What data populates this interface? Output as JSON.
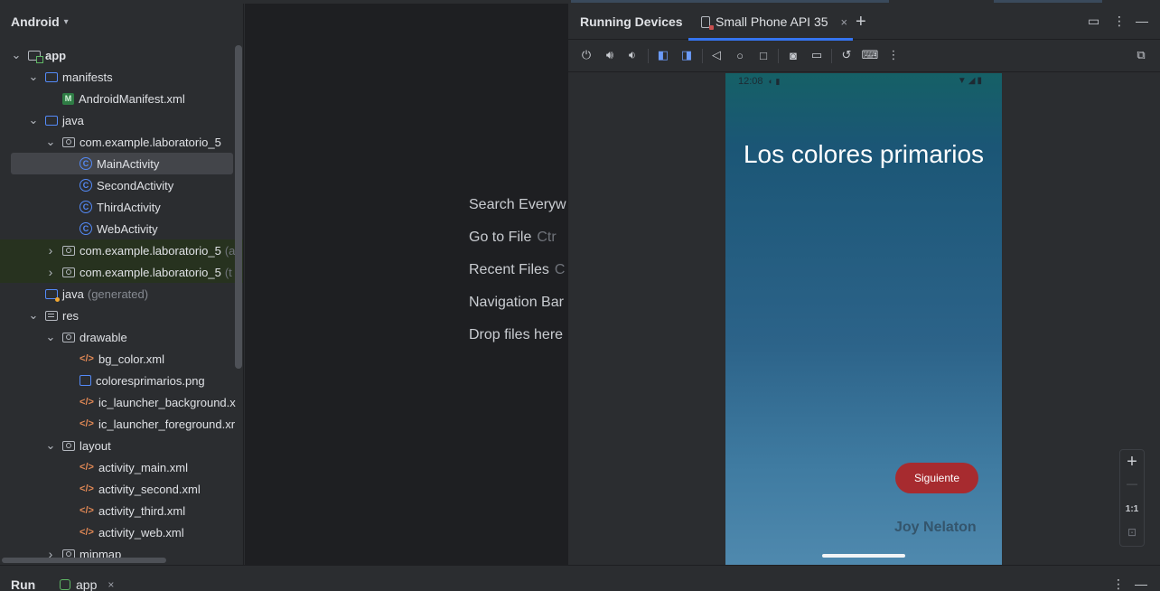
{
  "project": {
    "header": "Android",
    "items": [
      {
        "label": "app",
        "suffix": "",
        "type": "folder-app",
        "arrow": "open"
      },
      {
        "label": "manifests",
        "suffix": "",
        "type": "folder",
        "arrow": "open"
      },
      {
        "label": "AndroidManifest.xml",
        "suffix": "",
        "type": "manifest",
        "arrow": "none"
      },
      {
        "label": "java",
        "suffix": "",
        "type": "folder",
        "arrow": "open"
      },
      {
        "label": "com.example.laboratorio_5",
        "suffix": "",
        "type": "pkg",
        "arrow": "open"
      },
      {
        "label": "MainActivity",
        "suffix": "",
        "type": "cls",
        "arrow": "none",
        "selected": true
      },
      {
        "label": "SecondActivity",
        "suffix": "",
        "type": "cls",
        "arrow": "none"
      },
      {
        "label": "ThirdActivity",
        "suffix": "",
        "type": "cls",
        "arrow": "none"
      },
      {
        "label": "WebActivity",
        "suffix": "",
        "type": "cls",
        "arrow": "none"
      },
      {
        "label": "com.example.laboratorio_5",
        "suffix": "(a",
        "type": "pkg",
        "arrow": "closed",
        "green": true
      },
      {
        "label": "com.example.laboratorio_5",
        "suffix": "(t",
        "type": "pkg",
        "arrow": "closed",
        "green": true
      },
      {
        "label": "java",
        "suffix": "(generated)",
        "type": "gen",
        "arrow": "none"
      },
      {
        "label": "res",
        "suffix": "",
        "type": "res",
        "arrow": "open"
      },
      {
        "label": "drawable",
        "suffix": "",
        "type": "pkg",
        "arrow": "open"
      },
      {
        "label": "bg_color.xml",
        "suffix": "",
        "type": "xml",
        "arrow": "none"
      },
      {
        "label": "coloresprimarios.png",
        "suffix": "",
        "type": "img",
        "arrow": "none"
      },
      {
        "label": "ic_launcher_background.x",
        "suffix": "",
        "type": "xml",
        "arrow": "none"
      },
      {
        "label": "ic_launcher_foreground.xr",
        "suffix": "",
        "type": "xml",
        "arrow": "none"
      },
      {
        "label": "layout",
        "suffix": "",
        "type": "pkg",
        "arrow": "open"
      },
      {
        "label": "activity_main.xml",
        "suffix": "",
        "type": "xml",
        "arrow": "none"
      },
      {
        "label": "activity_second.xml",
        "suffix": "",
        "type": "xml",
        "arrow": "none"
      },
      {
        "label": "activity_third.xml",
        "suffix": "",
        "type": "xml",
        "arrow": "none"
      },
      {
        "label": "activity_web.xml",
        "suffix": "",
        "type": "xml",
        "arrow": "none"
      },
      {
        "label": "mipmap",
        "suffix": "",
        "type": "pkg",
        "arrow": "closed"
      }
    ]
  },
  "editor": {
    "hints": [
      {
        "label": "Search Everyw",
        "shortcut": ""
      },
      {
        "label": "Go to File",
        "shortcut": "Ctr"
      },
      {
        "label": "Recent Files",
        "shortcut": "C"
      },
      {
        "label": "Navigation Bar",
        "shortcut": ""
      },
      {
        "label": "Drop files here",
        "shortcut": ""
      }
    ]
  },
  "devices": {
    "title": "Running Devices",
    "tab_label": "Small Phone API 35",
    "close_glyph": "×",
    "add_glyph": "+"
  },
  "phone": {
    "time": "12:08",
    "title": "Los colores primarios",
    "button_label": "Siguiente",
    "author": "Joy Nelaton"
  },
  "zoom": {
    "plus": "+",
    "minus": "—",
    "ratio": "1:1"
  },
  "bottom": {
    "run_label": "Run",
    "config_label": "app"
  },
  "colors": {
    "accent": "#3574f0",
    "button": "#a72b2f",
    "selection": "#43454a"
  }
}
